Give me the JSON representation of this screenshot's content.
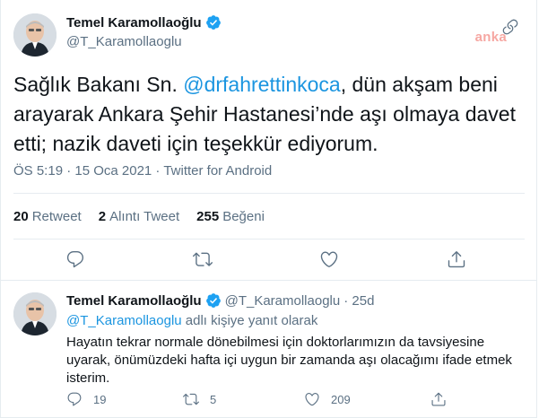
{
  "main_tweet": {
    "display_name": "Temel Karamollaoğlu",
    "handle": "@T_Karamollaoglu",
    "watermark": "anka",
    "text_before": "Sağlık Bakanı Sn. ",
    "mention": "@drfahrettinkoca",
    "text_after": ", dün akşam beni arayarak Ankara Şehir Hastanesi’nde aşı olmaya davet etti; nazik daveti için teşekkür ediyorum.",
    "meta": "ÖS 5:19 · 15 Oca 2021 · Twitter for Android",
    "stats": {
      "retweets_count": "20",
      "retweets_label": "Retweet",
      "quotes_count": "2",
      "quotes_label": "Alıntı Tweet",
      "likes_count": "255",
      "likes_label": "Beğeni"
    },
    "action_icons": [
      "reply-icon",
      "retweet-icon",
      "like-icon",
      "share-icon"
    ]
  },
  "reply_tweet": {
    "display_name": "Temel Karamollaoğlu",
    "handle": "@T_Karamollaoglu",
    "time": "· 25d",
    "reply_to_mention": "@T_Karamollaoglu",
    "reply_to_suffix": " adlı kişiye yanıt olarak",
    "text": "Hayatın tekrar normale dönebilmesi için doktorlarımızın da tavsiyesine uyarak, önümüzdeki hafta içi uygun bir zamanda aşı olacağımı ifade etmek isterim.",
    "reply_count": "19",
    "retweet_count": "5",
    "like_count": "209"
  },
  "colors": {
    "accent": "#1da1f2",
    "mention": "#1b95e0",
    "muted": "#5b7083",
    "text": "#0f1419",
    "border": "#e6ecf0"
  }
}
